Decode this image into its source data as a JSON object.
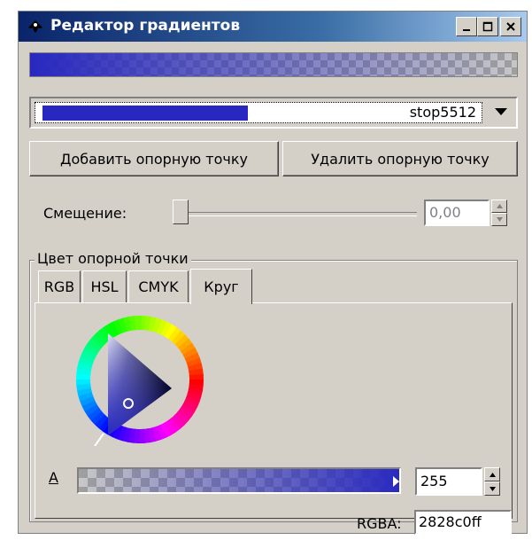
{
  "window": {
    "title": "Редактор градиентов",
    "controls": {
      "minimize": "_",
      "maximize": "□",
      "close": "×"
    }
  },
  "gradient": {
    "color_hex": "#2828c0",
    "stop_name": "stop5512"
  },
  "buttons": {
    "add_stop": "Добавить опорную точку",
    "remove_stop": "Удалить опорную точку"
  },
  "offset": {
    "label": "Смещение:",
    "value": "0,00",
    "slider_fraction": 0.0
  },
  "stop_color": {
    "group_label": "Цвет опорной точки",
    "tabs": [
      {
        "label": "RGB",
        "active": false
      },
      {
        "label": "HSL",
        "active": false
      },
      {
        "label": "CMYK",
        "active": false
      },
      {
        "label": "Круг",
        "active": true
      }
    ],
    "alpha_label": "A",
    "alpha_value": "255",
    "rgba_label": "RGBA:",
    "rgba_value": "2828c0ff"
  },
  "icons": {
    "title_icon": "inkscape-icon",
    "combo_arrow": "triangle-down-icon"
  }
}
